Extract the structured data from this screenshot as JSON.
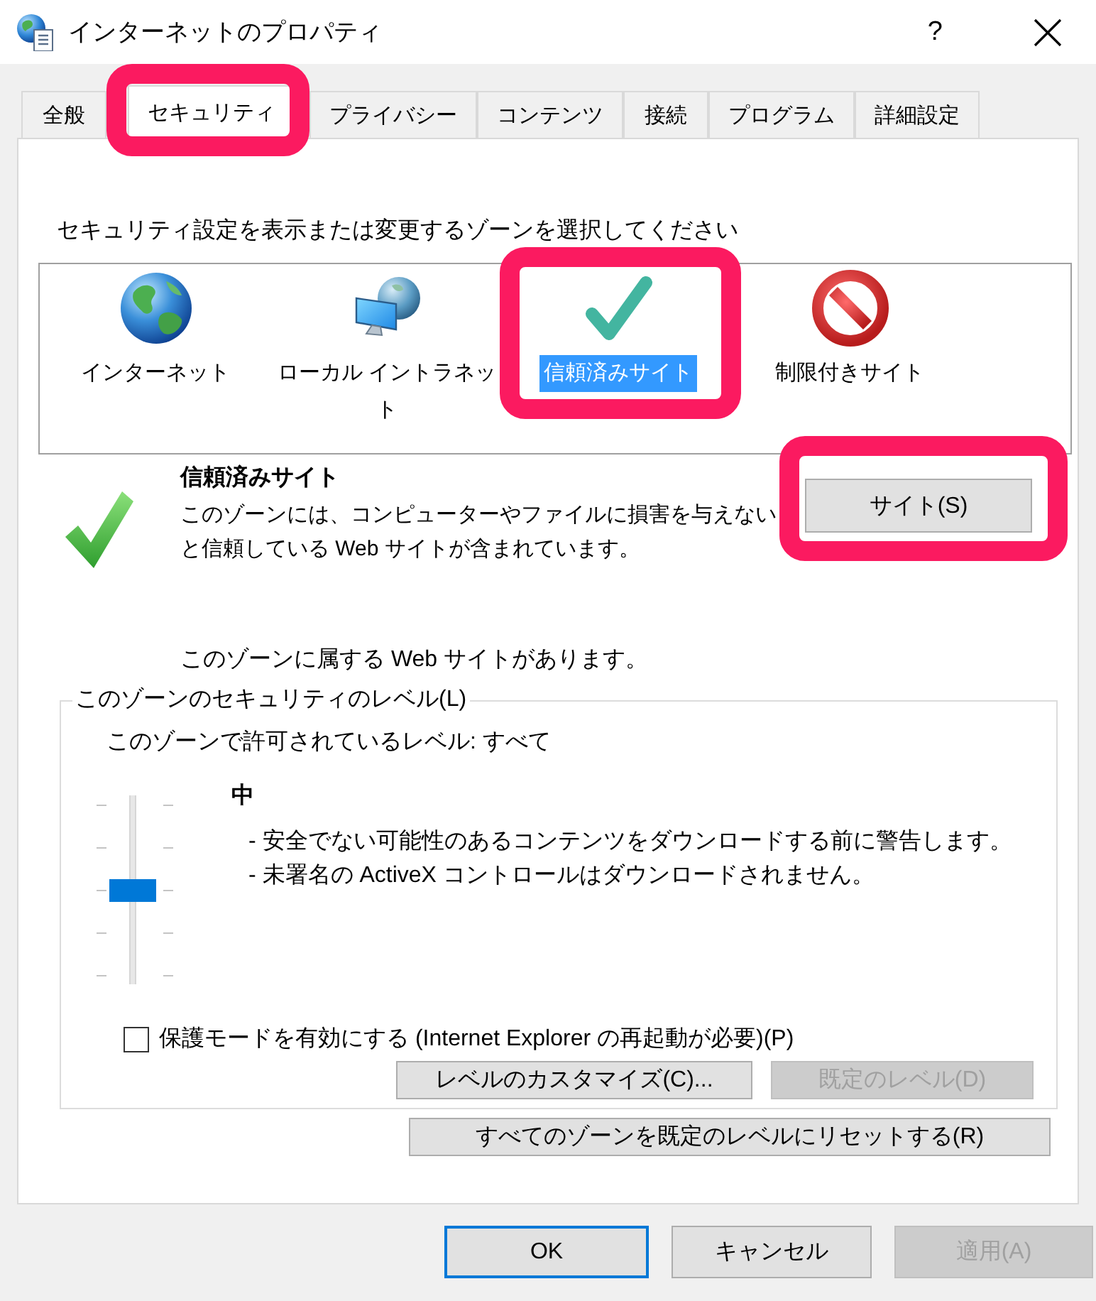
{
  "window": {
    "title": "インターネットのプロパティ",
    "help_button": "?"
  },
  "tabs": [
    {
      "label": "全般",
      "selected": false,
      "highlighted": false
    },
    {
      "label": "セキュリティ",
      "selected": true,
      "highlighted": true
    },
    {
      "label": "プライバシー",
      "selected": false,
      "highlighted": false
    },
    {
      "label": "コンテンツ",
      "selected": false,
      "highlighted": false
    },
    {
      "label": "接続",
      "selected": false,
      "highlighted": false
    },
    {
      "label": "プログラム",
      "selected": false,
      "highlighted": false
    },
    {
      "label": "詳細設定",
      "selected": false,
      "highlighted": false
    }
  ],
  "zone_prompt": "セキュリティ設定を表示または変更するゾーンを選択してください",
  "zones": [
    {
      "kind": "internet",
      "label": "インターネット",
      "selected": false,
      "highlighted": false
    },
    {
      "kind": "intranet",
      "label": "ローカル イントラネット",
      "selected": false,
      "highlighted": false
    },
    {
      "kind": "trusted",
      "label": "信頼済みサイト",
      "selected": true,
      "highlighted": true
    },
    {
      "kind": "restricted",
      "label": "制限付きサイト",
      "selected": false,
      "highlighted": false
    }
  ],
  "zone_info": {
    "kind": "trusted",
    "title": "信頼済みサイト",
    "description": "このゾーンには、コンピューターやファイルに損害を与えないと信頼している Web サイトが含まれています。",
    "sites_button": {
      "label": "サイト(S)",
      "highlighted": true
    },
    "note": "このゾーンに属する Web サイトがあります。"
  },
  "security_level": {
    "legend": "このゾーンのセキュリティのレベル(L)",
    "allowed": "このゾーンで許可されているレベル: すべて",
    "slider": {
      "level": 0.5
    },
    "level_name": "中",
    "details": [
      "- 安全でない可能性のあるコンテンツをダウンロードする前に警告します。",
      "- 未署名の ActiveX コントロールはダウンロードされません。"
    ],
    "protected_mode": {
      "label": "保護モードを有効にする (Internet Explorer の再起動が必要)(P)",
      "checked": false
    },
    "buttons": [
      {
        "label": "レベルのカスタマイズ(C)...",
        "disabled": false
      },
      {
        "label": "既定のレベル(D)",
        "disabled": true
      }
    ]
  },
  "reset_button": {
    "label": "すべてのゾーンを既定のレベルにリセットする(R)"
  },
  "buttons": [
    {
      "label": "OK",
      "default": true,
      "disabled": false
    },
    {
      "label": "キャンセル",
      "default": false,
      "disabled": false
    },
    {
      "label": "適用(A)",
      "default": false,
      "disabled": true
    }
  ]
}
